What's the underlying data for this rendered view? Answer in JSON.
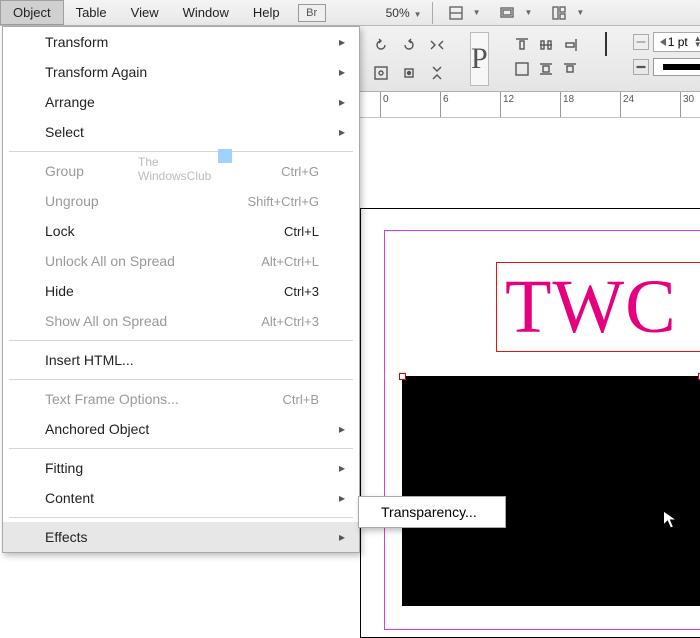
{
  "menubar": {
    "items": [
      "Object",
      "Table",
      "View",
      "Window",
      "Help"
    ],
    "br_label": "Br",
    "zoom": "50%"
  },
  "toolbar": {
    "para_glyph": "P",
    "stroke_pt": "1 pt"
  },
  "ruler": {
    "marks": [
      "0",
      "6",
      "12",
      "18",
      "24",
      "30"
    ]
  },
  "canvas": {
    "twc_text": "TWC"
  },
  "menu": {
    "items": [
      {
        "label": "Transform",
        "submenu": true
      },
      {
        "label": "Transform Again",
        "submenu": true
      },
      {
        "label": "Arrange",
        "submenu": true
      },
      {
        "label": "Select",
        "submenu": true
      },
      {
        "sep": true
      },
      {
        "label": "Group",
        "shortcut": "Ctrl+G",
        "disabled": true
      },
      {
        "label": "Ungroup",
        "shortcut": "Shift+Ctrl+G",
        "disabled": true
      },
      {
        "label": "Lock",
        "shortcut": "Ctrl+L"
      },
      {
        "label": "Unlock All on Spread",
        "shortcut": "Alt+Ctrl+L",
        "disabled": true
      },
      {
        "label": "Hide",
        "shortcut": "Ctrl+3"
      },
      {
        "label": "Show All on Spread",
        "shortcut": "Alt+Ctrl+3",
        "disabled": true
      },
      {
        "sep": true
      },
      {
        "label": "Insert HTML..."
      },
      {
        "sep": true
      },
      {
        "label": "Text Frame Options...",
        "shortcut": "Ctrl+B",
        "disabled": true
      },
      {
        "label": "Anchored Object",
        "submenu": true
      },
      {
        "sep": true
      },
      {
        "label": "Fitting",
        "submenu": true
      },
      {
        "label": "Content",
        "submenu": true
      },
      {
        "sep": true
      },
      {
        "label": "Effects",
        "submenu": true,
        "hov": true
      }
    ],
    "sub_effects": {
      "first": "Transparency..."
    }
  },
  "watermark": {
    "line1": "The",
    "line2": "WindowsClub"
  }
}
